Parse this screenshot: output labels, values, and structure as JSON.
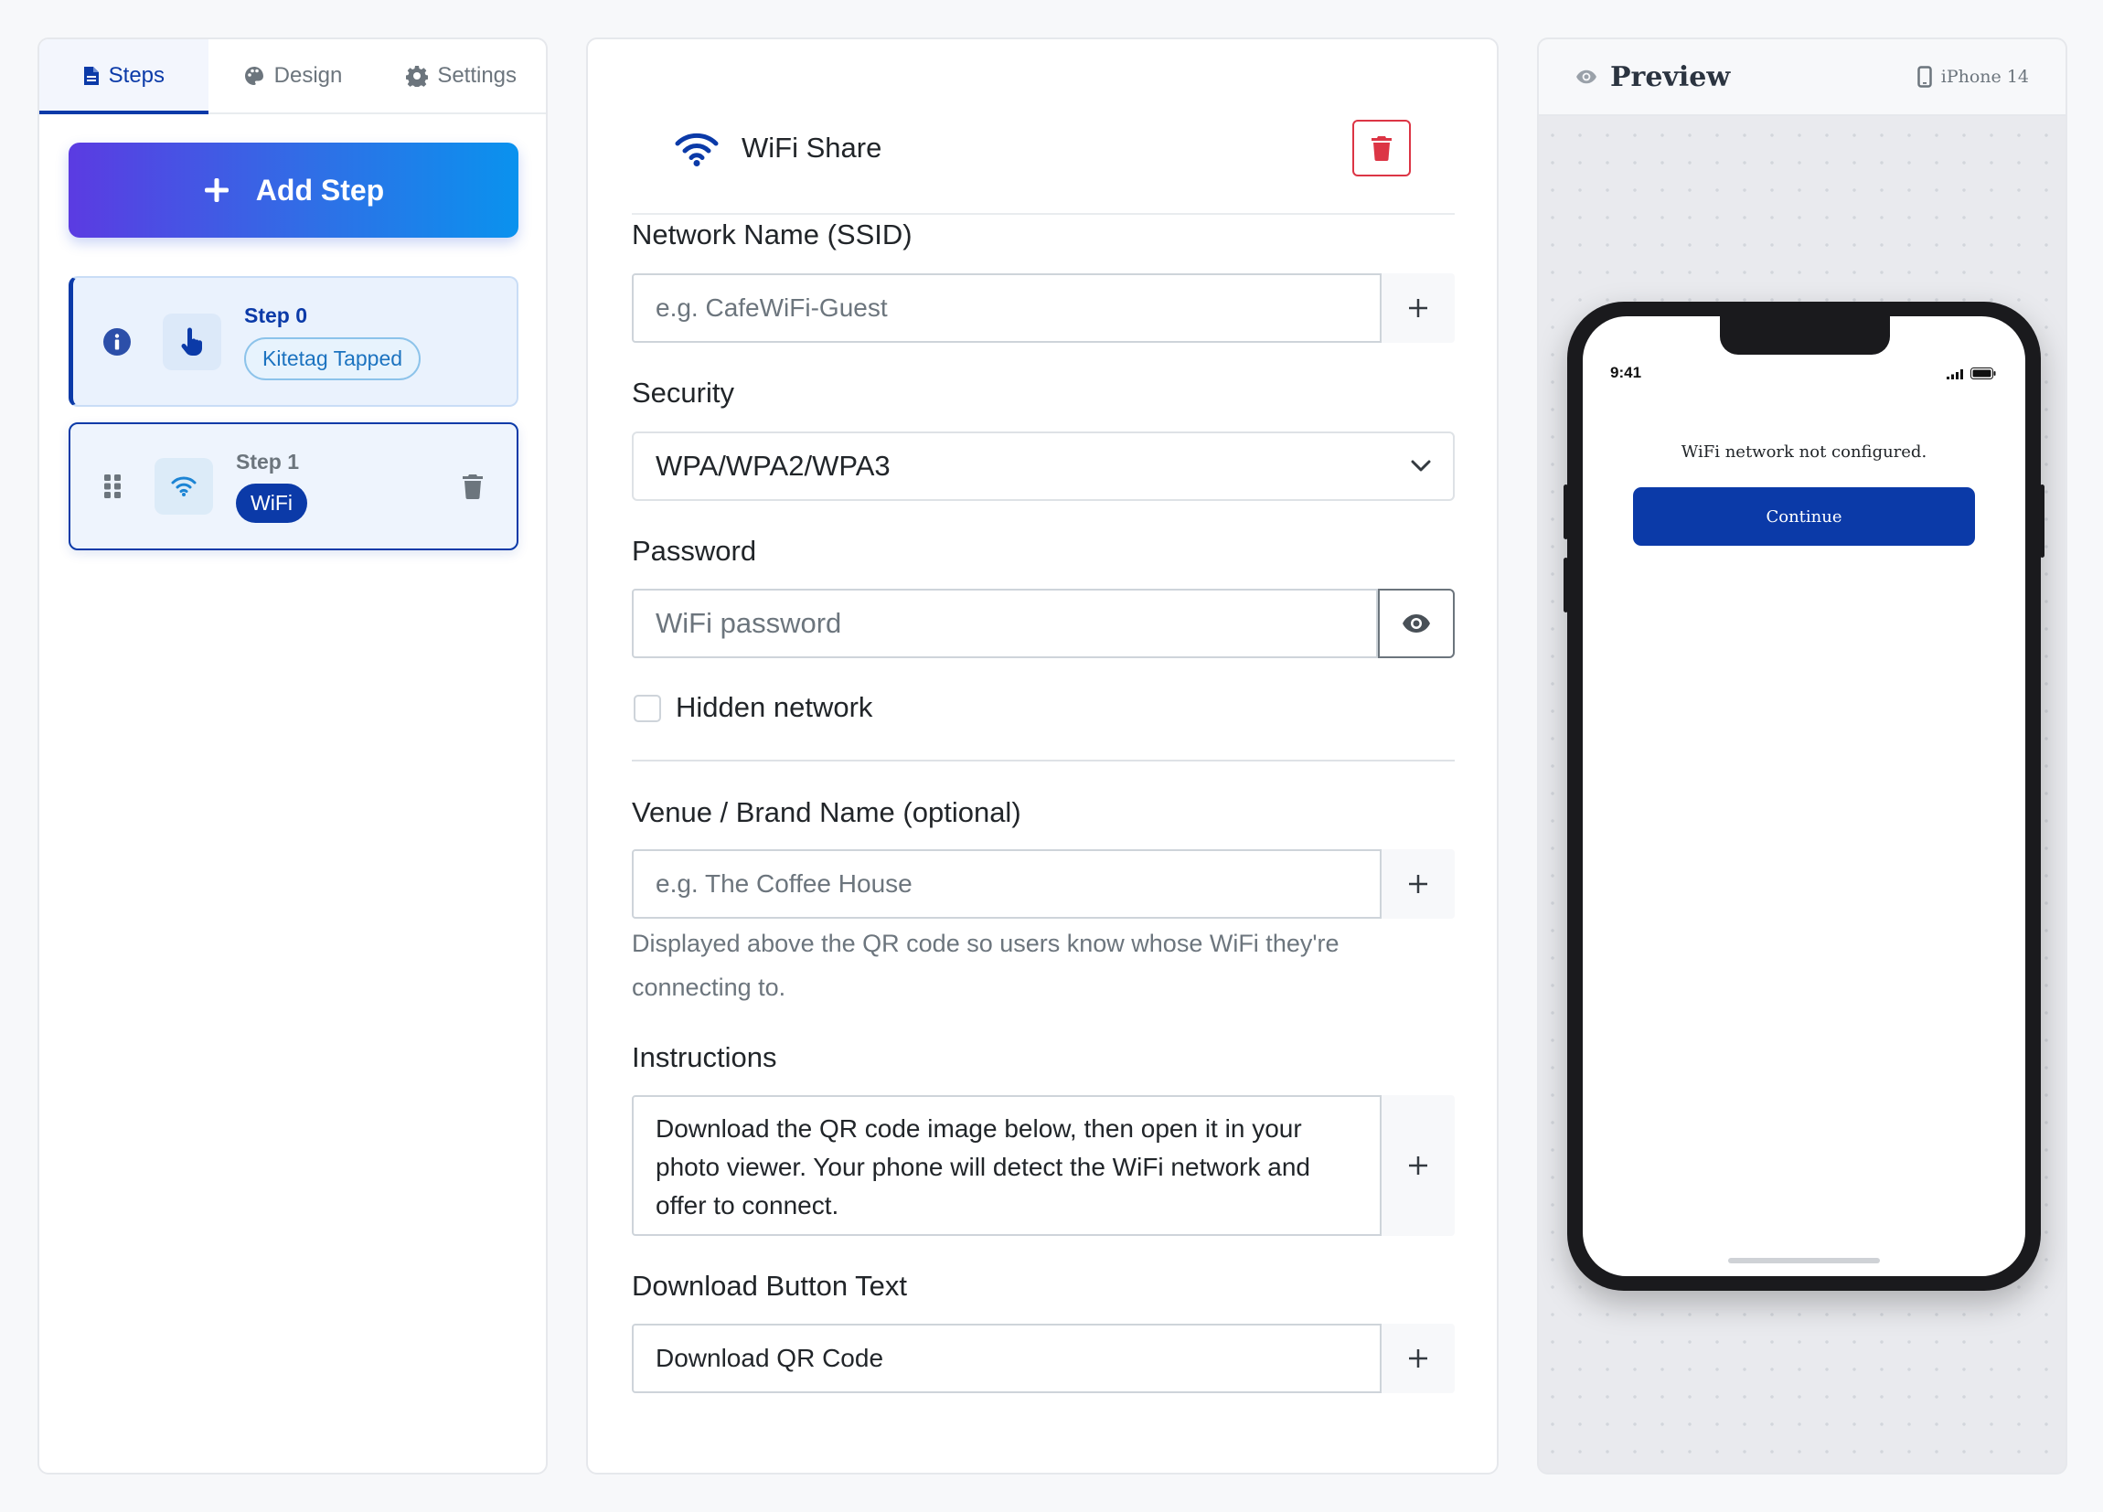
{
  "tabs": [
    {
      "label": "Steps",
      "active": true,
      "icon": "file-icon"
    },
    {
      "label": "Design",
      "active": false,
      "icon": "palette-icon"
    },
    {
      "label": "Settings",
      "active": false,
      "icon": "gear-icon"
    }
  ],
  "add_step": {
    "label": "Add Step"
  },
  "steps": [
    {
      "title": "Step 0",
      "badge": "Kitetag Tapped",
      "icon": "hand-pointer-icon",
      "status_icon": "info-icon"
    },
    {
      "title": "Step 1",
      "badge": "WiFi",
      "icon": "wifi-icon",
      "drag_icon": "grip-icon",
      "delete_icon": "trash-icon"
    }
  ],
  "editor": {
    "title": "WiFi Share",
    "ssid": {
      "label": "Network Name (SSID)",
      "placeholder": "e.g. CafeWiFi-Guest",
      "value": ""
    },
    "security": {
      "label": "Security",
      "value": "WPA/WPA2/WPA3"
    },
    "password": {
      "label": "Password",
      "placeholder": "WiFi password",
      "value": ""
    },
    "hidden_network": {
      "label": "Hidden network",
      "checked": false
    },
    "venue": {
      "label": "Venue / Brand Name (optional)",
      "placeholder": "e.g. The Coffee House",
      "value": "",
      "help_line1": "Displayed above the QR code so users know whose WiFi they're",
      "help_line2": "connecting to."
    },
    "instructions": {
      "label": "Instructions",
      "value": "Download the QR code image below, then open it in your photo viewer. Your phone will detect the WiFi network and offer to connect."
    },
    "download_button": {
      "label": "Download Button Text",
      "value": "Download QR Code"
    }
  },
  "preview": {
    "title": "Preview",
    "device": "iPhone 14",
    "time": "9:41",
    "message": "WiFi network not configured.",
    "button": "Continue"
  },
  "colors": {
    "primary": "#0b3aa8",
    "danger": "#dc3545",
    "gradient_start": "#5b3be2",
    "gradient_end": "#0a92ee",
    "badge_blue": "#1c73c0"
  }
}
